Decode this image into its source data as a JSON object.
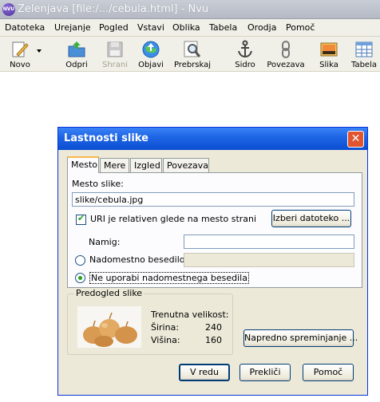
{
  "app": {
    "title": "Zelenjava [file:/.../cebula.html] - Nvu",
    "logo_text": "NVU"
  },
  "menubar": {
    "items": [
      {
        "label": "Datoteka"
      },
      {
        "label": "Urejanje"
      },
      {
        "label": "Pogled"
      },
      {
        "label": "Vstavi"
      },
      {
        "label": "Oblika"
      },
      {
        "label": "Tabela"
      },
      {
        "label": "Orodja"
      },
      {
        "label": "Pomoč"
      }
    ]
  },
  "toolbar": {
    "buttons": [
      {
        "label": "Novo",
        "icon": "pencil-icon",
        "enabled": true
      },
      {
        "label": "Odpri",
        "icon": "open-folder-icon",
        "enabled": true
      },
      {
        "label": "Shrani",
        "icon": "floppy-disk-icon",
        "enabled": false
      },
      {
        "label": "Objavi",
        "icon": "publish-globe-icon",
        "enabled": true
      },
      {
        "label": "Prebrskaj",
        "icon": "magnifier-icon",
        "enabled": true
      },
      {
        "label": "Sidro",
        "icon": "anchor-icon",
        "enabled": true
      },
      {
        "label": "Povezava",
        "icon": "link-chain-icon",
        "enabled": true
      },
      {
        "label": "Slika",
        "icon": "image-icon",
        "enabled": true
      },
      {
        "label": "Tabela",
        "icon": "table-icon",
        "enabled": true
      }
    ]
  },
  "dialog": {
    "title": "Lastnosti slike",
    "close_symbol": "✕",
    "tabs": [
      {
        "label": "Mesto",
        "active": true
      },
      {
        "label": "Mere",
        "active": false
      },
      {
        "label": "Izgled",
        "active": false
      },
      {
        "label": "Povezava",
        "active": false
      }
    ],
    "location": {
      "label": "Mesto slike:",
      "value": "slike/cebula.jpg",
      "relative_checkbox_label": "URI je relativen glede na mesto strani",
      "relative_checked": true,
      "choose_file_button": "Izberi datoteko ..."
    },
    "tooltip": {
      "label": "Namig:",
      "value": ""
    },
    "alt_text": {
      "option_label": "Nadomestno besedilo:",
      "value": "",
      "none_option_label": "Ne uporabi nadomestnega besedila",
      "selected": "none"
    },
    "preview": {
      "legend": "Predogled slike",
      "current_size_label": "Trenutna velikost:",
      "width_label": "Širina:",
      "width_value": "240",
      "height_label": "Višina:",
      "height_value": "160"
    },
    "advanced_button": "Napredno spreminjanje ...",
    "buttons": {
      "ok": "V redu",
      "cancel": "Prekliči",
      "help": "Pomoč"
    }
  },
  "colors": {
    "dialog_title_bar": "#1f66e5",
    "dialog_face": "#ece9d8",
    "close_button": "#e0552f",
    "active_tab_accent": "#f7b84b",
    "check_green": "#21a121"
  }
}
